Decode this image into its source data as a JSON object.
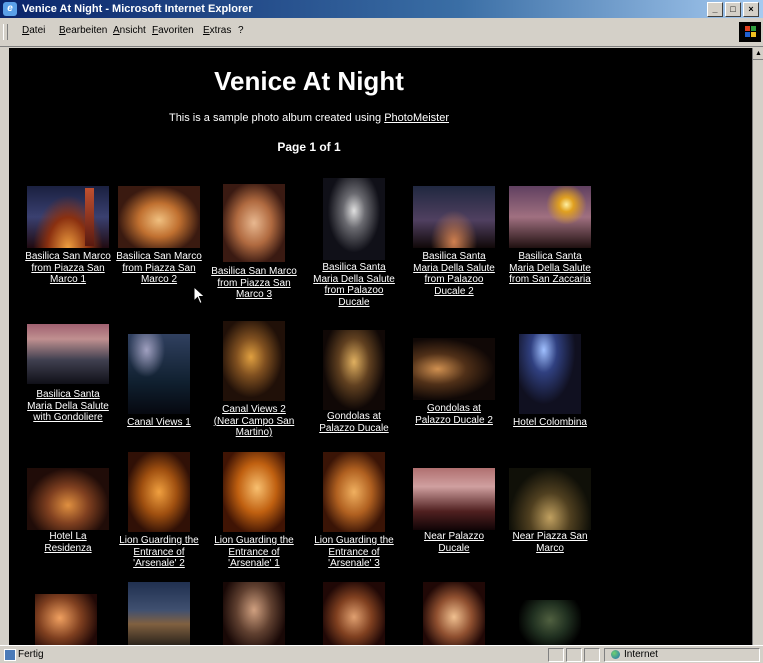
{
  "window": {
    "title": "Venice At Night - Microsoft Internet Explorer"
  },
  "menu": [
    "Datei",
    "Bearbeiten",
    "Ansicht",
    "Favoriten",
    "Extras",
    "?"
  ],
  "page": {
    "heading": "Venice At Night",
    "subtitle_prefix": "This is a sample photo album created using ",
    "subtitle_link": "PhotoMeister",
    "page_info": "Page 1 of 1"
  },
  "photos": [
    {
      "caption": "Basilica San Marco from Piazza San Marco 1"
    },
    {
      "caption": "Basilica San Marco from Piazza San Marco 2"
    },
    {
      "caption": "Basilica San Marco from Piazza San Marco 3"
    },
    {
      "caption": "Basilica Santa Maria Della Salute from Palazoo Ducale"
    },
    {
      "caption": "Basilica Santa Maria Della Salute from Palazoo Ducale 2"
    },
    {
      "caption": "Basilica Santa Maria Della Salute from San Zaccaria"
    },
    {
      "caption": "Basilica Santa Maria Della Salute with Gondoliere"
    },
    {
      "caption": "Canal Views 1"
    },
    {
      "caption": "Canal Views 2 (Near Campo San Martino)"
    },
    {
      "caption": "Gondolas at Palazzo Ducale"
    },
    {
      "caption": "Gondolas at Palazzo Ducale 2"
    },
    {
      "caption": "Hotel Colombina"
    },
    {
      "caption": "Hotel La Residenza"
    },
    {
      "caption": "Lion Guarding the Entrance of 'Arsenale' 2"
    },
    {
      "caption": "Lion Guarding the Entrance of 'Arsenale' 1"
    },
    {
      "caption": "Lion Guarding the Entrance of 'Arsenale' 3"
    },
    {
      "caption": "Near Palazzo Ducale"
    },
    {
      "caption": "Near Piazza San Marco"
    }
  ],
  "status": {
    "text": "Fertig",
    "zone": "Internet"
  },
  "colors": {
    "page_bg": "#000000",
    "text": "#ffffff",
    "chrome": "#d4d0c8",
    "titlebar": "#0a246a"
  }
}
